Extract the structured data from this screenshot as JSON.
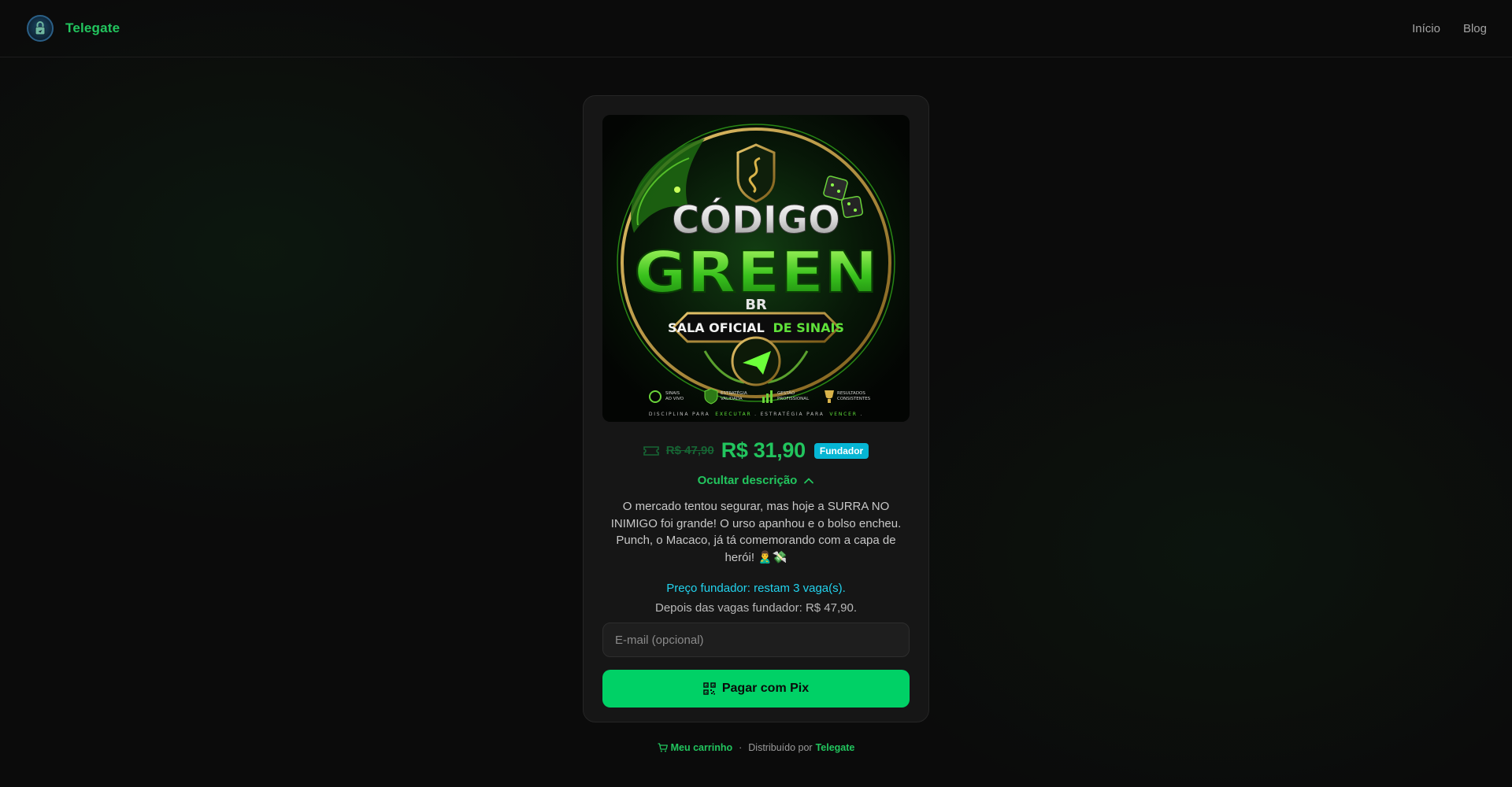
{
  "header": {
    "brand_name": "Telegate",
    "nav": [
      {
        "label": "Início"
      },
      {
        "label": "Blog"
      }
    ]
  },
  "product": {
    "cover": {
      "line1": "CÓDIGO",
      "line2": "GREEN",
      "line3": "BR",
      "banner_white": "SALA OFICIAL",
      "banner_green": "DE SINAIS",
      "features": [
        {
          "line1": "SINAIS",
          "line2": "AO VIVO"
        },
        {
          "line1": "ESTRATÉGIA",
          "line2": "VALIDADA"
        },
        {
          "line1": "GESTÃO",
          "line2": "PROFISSIONAL"
        },
        {
          "line1": "RESULTADOS",
          "line2": "CONSISTENTES"
        }
      ],
      "tagline_1": "DISCIPLINA PARA",
      "tagline_2": "EXECUTAR",
      "tagline_3": ". ESTRATÉGIA PARA",
      "tagline_4": "VENCER",
      "tagline_5": "."
    },
    "old_price": "R$ 47,90",
    "new_price": "R$ 31,90",
    "badge": "Fundador",
    "toggle_label": "Ocultar descrição",
    "description": "O mercado tentou segurar, mas hoje a SURRA NO INIMIGO foi grande! O urso apanhou e o bolso encheu. Punch, o Macaco, já tá comemorando com a capa de herói! 🙎‍♂️💸",
    "founder_note": "Preço fundador: restam 3 vaga(s).",
    "after_note": "Depois das vagas fundador: R$ 47,90.",
    "email_placeholder": "E-mail (opcional)",
    "pay_button": "Pagar com Pix"
  },
  "footer": {
    "cart_label": "Meu carrinho",
    "separator": "·",
    "distributed_by": "Distribuído por",
    "distributor": "Telegate"
  },
  "colors": {
    "accent": "#22c55e",
    "button": "#00d166",
    "badge": "#06b6d4",
    "founder_note": "#22d3ee"
  }
}
